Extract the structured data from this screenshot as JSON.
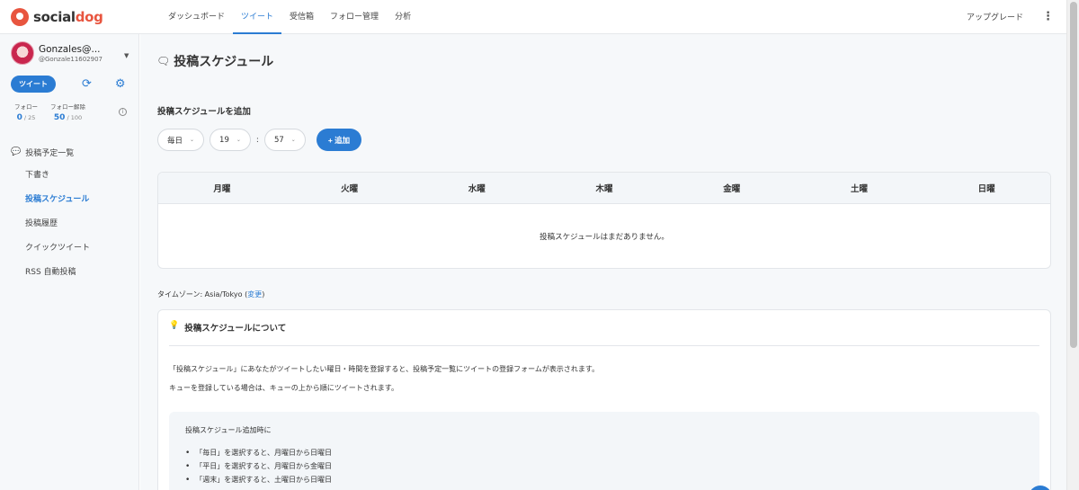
{
  "brand": {
    "name_part1": "social",
    "name_part2": "dog"
  },
  "nav": {
    "items": [
      "ダッシュボード",
      "ツイート",
      "受信箱",
      "フォロー管理",
      "分析"
    ],
    "active_index": 1,
    "upgrade": "アップグレード",
    "more_icon": "⋮"
  },
  "profile": {
    "name": "Gonzales@...",
    "handle": "@Gonzale11602907"
  },
  "sidebar": {
    "tweet_button": "ツイート",
    "stats": [
      {
        "label": "フォロー",
        "value": "0",
        "max": " / 25"
      },
      {
        "label": "フォロー解除",
        "value": "50",
        "max": " / 100"
      }
    ],
    "menu_head": "投稿予定一覧",
    "menu_items": [
      "下書き",
      "投稿スケジュール",
      "投稿履歴",
      "クイックツイート",
      "RSS 自動投稿"
    ],
    "active_index": 1
  },
  "main": {
    "page_title": "投稿スケジュール",
    "add_section_title": "投稿スケジュールを追加",
    "freq_value": "毎日",
    "hour_value": "19",
    "colon": ":",
    "minute_value": "57",
    "add_button": "+ 追加",
    "days": [
      "月曜",
      "火曜",
      "水曜",
      "木曜",
      "金曜",
      "土曜",
      "日曜"
    ],
    "empty_message": "投稿スケジュールはまだありません。",
    "timezone_label": "タイムゾーン: Asia/Tokyo",
    "timezone_open": " (",
    "timezone_change": "変更",
    "timezone_close": ")"
  },
  "about": {
    "title": "投稿スケジュールについて",
    "p1": "「投稿スケジュール」にあなたがツイートしたい曜日・時間を登録すると、投稿予定一覧にツイートの登録フォームが表示されます。",
    "p2": "キューを登録している場合は、キューの上から順にツイートされます。",
    "note_title": "投稿スケジュール追加時に",
    "note_items": [
      "「毎日」を選択すると、月曜日から日曜日",
      "「平日」を選択すると、月曜日から金曜日",
      "「週末」を選択すると、土曜日から日曜日"
    ]
  },
  "colors": {
    "accent": "#2b7cd3",
    "brand": "#e8553f"
  }
}
